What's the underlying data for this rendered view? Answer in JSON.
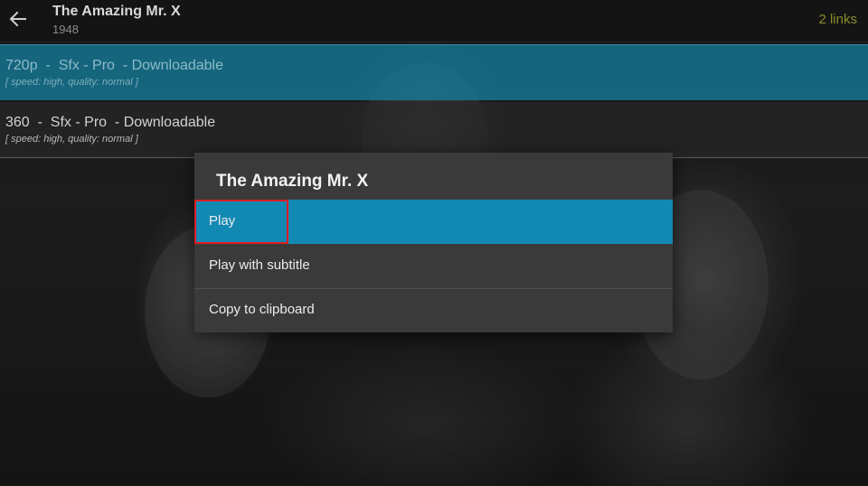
{
  "header": {
    "title": "The Amazing Mr. X",
    "year": "1948",
    "links_count": "2 links"
  },
  "links": [
    {
      "label": "720p  -  Sfx - Pro  - Downloadable",
      "meta": "[ speed: high, quality: normal ]"
    },
    {
      "label": "360  -  Sfx - Pro  - Downloadable",
      "meta": "[ speed: high, quality: normal ]"
    }
  ],
  "dialog": {
    "title": "The Amazing Mr. X",
    "items": [
      {
        "label": "Play"
      },
      {
        "label": "Play with subtitle"
      },
      {
        "label": "Copy to clipboard"
      }
    ]
  },
  "colors": {
    "accent": "#1289b3",
    "focus_outline": "#e01b24",
    "links_count": "#8a8a2e"
  },
  "icons": {
    "back": "arrow-left-icon"
  }
}
